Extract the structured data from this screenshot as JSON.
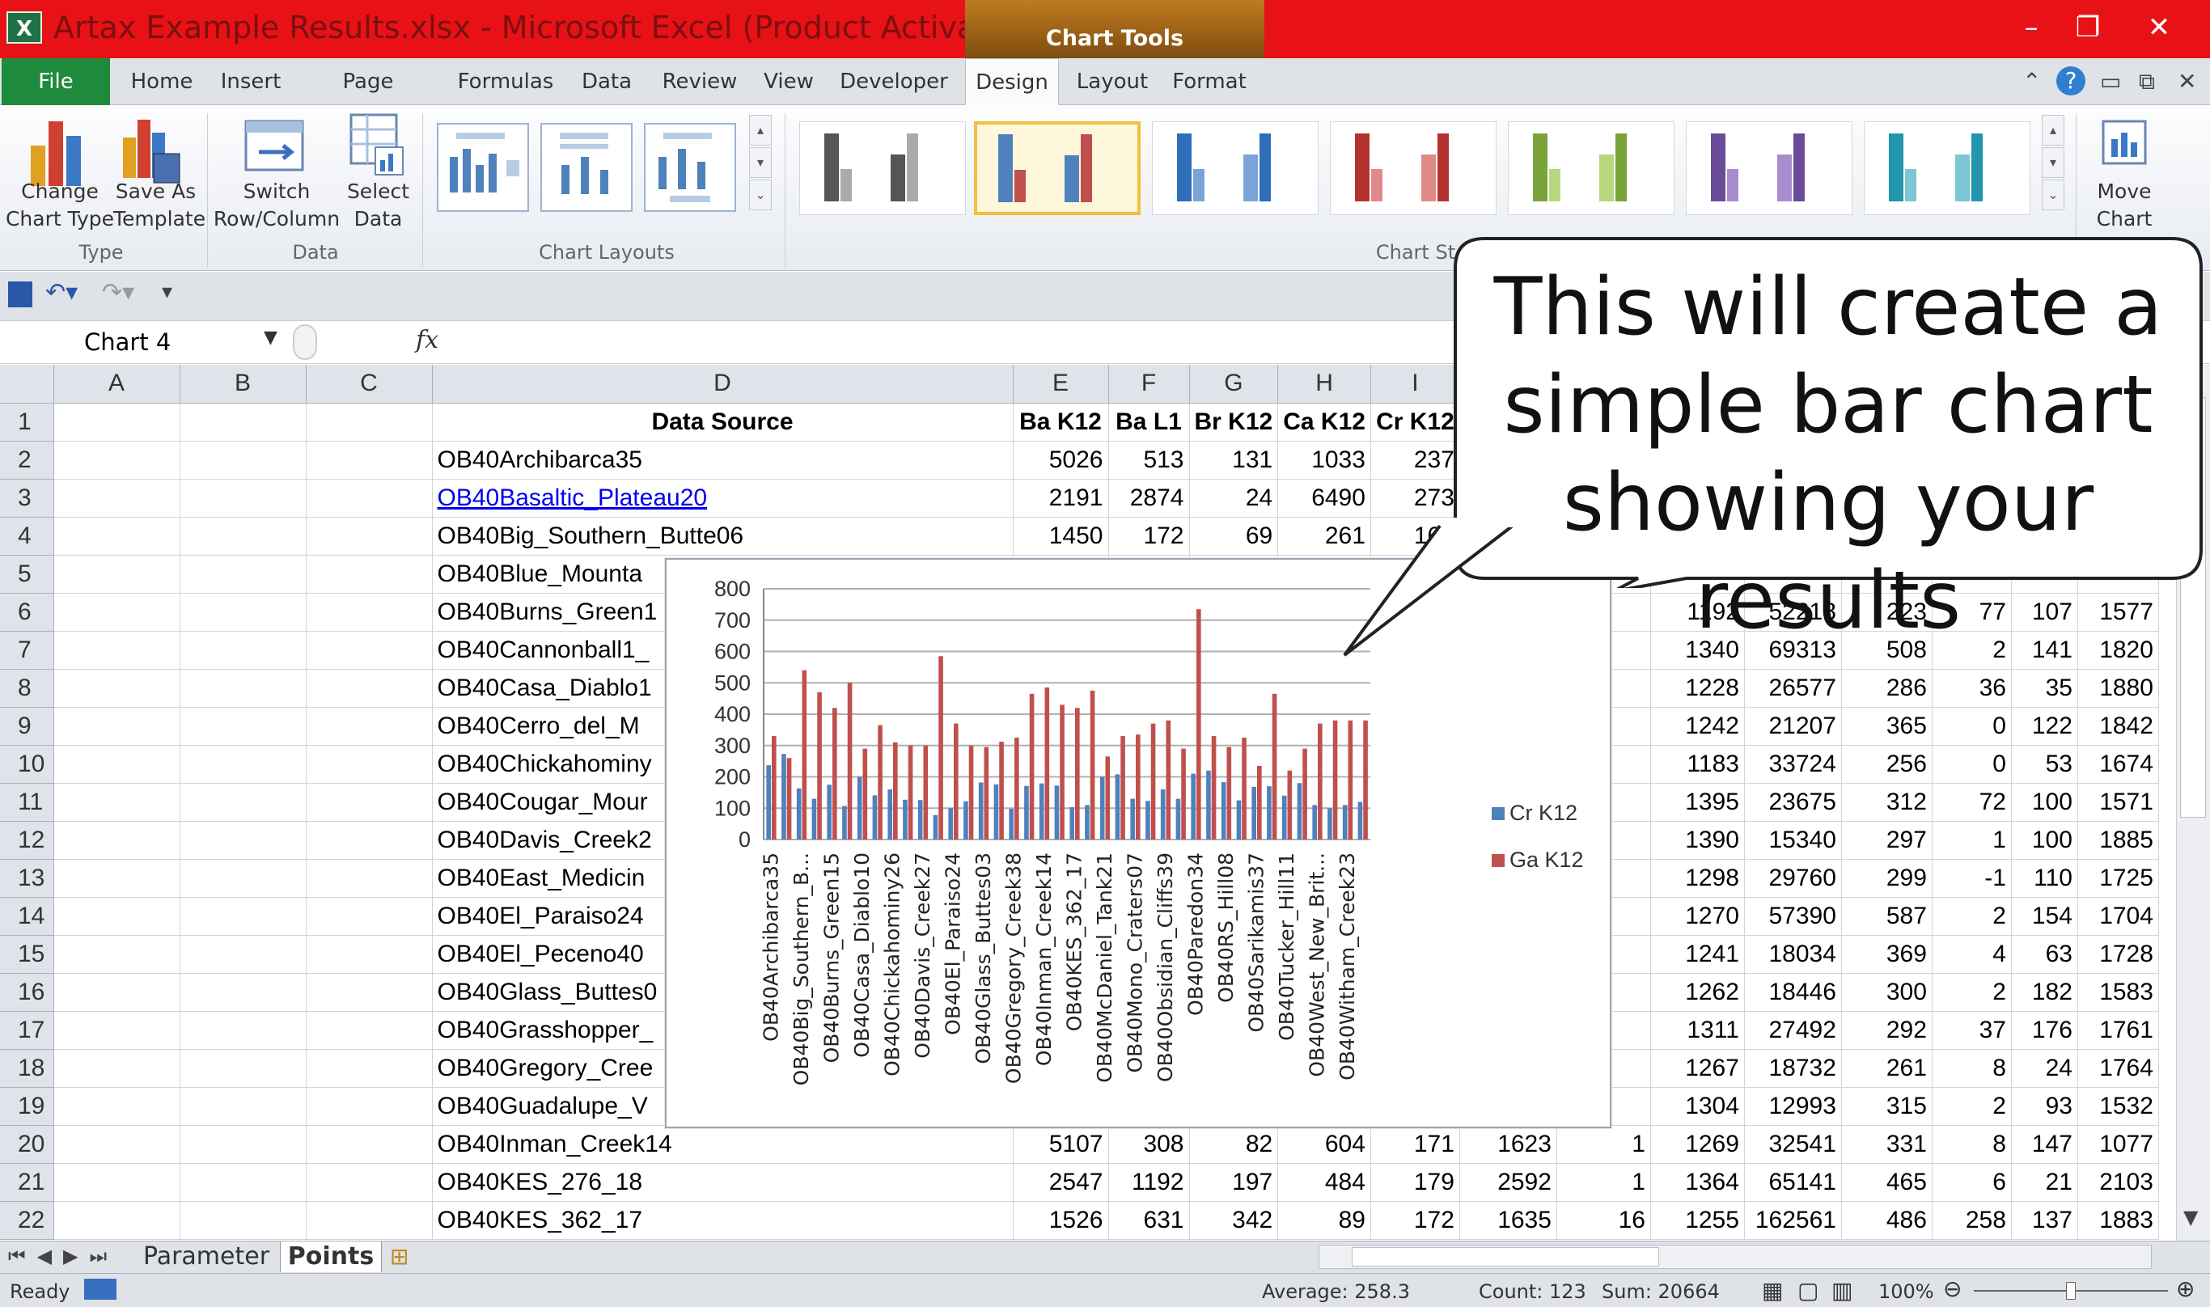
{
  "window": {
    "title": "Artax Example Results.xlsx - Microsoft Excel (Product Activation ...",
    "context_tab_group": "Chart Tools",
    "app_icon": "excel-icon",
    "accent": "#e81115",
    "file_tab_color": "#1e8a3c"
  },
  "tabs": [
    {
      "label": "File",
      "active": false
    },
    {
      "label": "Home",
      "active": false
    },
    {
      "label": "Insert",
      "active": false
    },
    {
      "label": "Page Layout",
      "active": false
    },
    {
      "label": "Formulas",
      "active": false
    },
    {
      "label": "Data",
      "active": false
    },
    {
      "label": "Review",
      "active": false
    },
    {
      "label": "View",
      "active": false
    },
    {
      "label": "Developer",
      "active": false
    },
    {
      "label": "Design",
      "active": true
    },
    {
      "label": "Layout",
      "active": false
    },
    {
      "label": "Format",
      "active": false
    }
  ],
  "ribbon": {
    "change_chart_type": [
      "Change",
      "Chart Type"
    ],
    "save_as_template": [
      "Save As",
      "Template"
    ],
    "switch_row_column": [
      "Switch",
      "Row/Column"
    ],
    "select_data": [
      "Select",
      "Data"
    ],
    "move_chart": [
      "Move",
      "Chart"
    ],
    "groups": {
      "type": "Type",
      "data": "Data",
      "layouts": "Chart Layouts",
      "styles": "Chart St"
    },
    "style_colors": [
      "#666666",
      "#4472c4/#c0504d",
      "#2f6eba",
      "#c0504d",
      "#8db43e",
      "#7a5aa6",
      "#2aa3bc"
    ]
  },
  "formula_bar": {
    "name_box": "Chart 4",
    "fx": "fx",
    "formula": ""
  },
  "columns": [
    "A",
    "B",
    "C",
    "D",
    "E",
    "F",
    "G",
    "H",
    "I"
  ],
  "rows": [
    {
      "n": "1",
      "d": "Data Source",
      "e": "Ba K12",
      "f": "Ba L1",
      "g": "Br K12",
      "h": "Ca K12",
      "i": "Cr K12"
    },
    {
      "n": "2",
      "d": "OB40Archibarca35",
      "e": "5026",
      "f": "513",
      "g": "131",
      "h": "1033",
      "i": "237"
    },
    {
      "n": "3",
      "d": "OB40Basaltic_Plateau20",
      "e": "2191",
      "f": "2874",
      "g": "24",
      "h": "6490",
      "i": "273"
    },
    {
      "n": "4",
      "d": "OB40Big_Southern_Butte06",
      "e": "1450",
      "f": "172",
      "g": "69",
      "h": "261",
      "i": "163"
    },
    {
      "n": "5",
      "d": "OB40Blue_Mounta",
      "r": [
        "",
        "",
        "",
        "",
        "",
        ""
      ]
    },
    {
      "n": "6",
      "d": "OB40Burns_Green1",
      "r": [
        "1192",
        "52218",
        "223",
        "77",
        "107",
        "1577"
      ]
    },
    {
      "n": "7",
      "d": "OB40Cannonball1_",
      "r": [
        "1340",
        "69313",
        "508",
        "2",
        "141",
        "1820"
      ]
    },
    {
      "n": "8",
      "d": "OB40Casa_Diablo1",
      "r": [
        "1228",
        "26577",
        "286",
        "36",
        "35",
        "1880"
      ]
    },
    {
      "n": "9",
      "d": "OB40Cerro_del_M",
      "r": [
        "1242",
        "21207",
        "365",
        "0",
        "122",
        "1842"
      ]
    },
    {
      "n": "10",
      "d": "OB40Chickahominy",
      "r": [
        "1183",
        "33724",
        "256",
        "0",
        "53",
        "1674"
      ]
    },
    {
      "n": "11",
      "d": "OB40Cougar_Mour",
      "r": [
        "1395",
        "23675",
        "312",
        "72",
        "100",
        "1571"
      ]
    },
    {
      "n": "12",
      "d": "OB40Davis_Creek2",
      "r": [
        "1390",
        "15340",
        "297",
        "1",
        "100",
        "1885"
      ]
    },
    {
      "n": "13",
      "d": "OB40East_Medicin",
      "r": [
        "1298",
        "29760",
        "299",
        "-1",
        "110",
        "1725"
      ]
    },
    {
      "n": "14",
      "d": "OB40El_Paraiso24",
      "r": [
        "1270",
        "57390",
        "587",
        "2",
        "154",
        "1704"
      ]
    },
    {
      "n": "15",
      "d": "OB40El_Peceno40",
      "r": [
        "1241",
        "18034",
        "369",
        "4",
        "63",
        "1728"
      ]
    },
    {
      "n": "16",
      "d": "OB40Glass_Buttes0",
      "r": [
        "1262",
        "18446",
        "300",
        "2",
        "182",
        "1583"
      ]
    },
    {
      "n": "17",
      "d": "OB40Grasshopper_",
      "r": [
        "1311",
        "27492",
        "292",
        "37",
        "176",
        "1761"
      ]
    },
    {
      "n": "18",
      "d": "OB40Gregory_Cree",
      "r": [
        "1267",
        "18732",
        "261",
        "8",
        "24",
        "1764"
      ]
    },
    {
      "n": "19",
      "d": "OB40Guadalupe_V",
      "r": [
        "1304",
        "12993",
        "315",
        "2",
        "93",
        "1532"
      ]
    },
    {
      "n": "20",
      "d": "OB40Inman_Creek14",
      "e": "5107",
      "f": "308",
      "g": "82",
      "h": "604",
      "i": "171",
      "r": [
        "1623",
        "1",
        "1269",
        "32541",
        "331",
        "8",
        "147",
        "1077"
      ]
    },
    {
      "n": "21",
      "d": "OB40KES_276_18",
      "e": "2547",
      "f": "1192",
      "g": "197",
      "h": "484",
      "i": "179",
      "r": [
        "2592",
        "1",
        "1364",
        "65141",
        "465",
        "6",
        "21",
        "2103"
      ]
    },
    {
      "n": "22",
      "d": "OB40KES_362_17",
      "e": "1526",
      "f": "631",
      "g": "342",
      "h": "89",
      "i": "172",
      "r": [
        "1635",
        "16",
        "1255",
        "162561",
        "486",
        "258",
        "137",
        "1883"
      ]
    }
  ],
  "sheet_tabs": [
    {
      "label": "Parameter",
      "active": false
    },
    {
      "label": "Points",
      "active": true
    }
  ],
  "status": {
    "ready": "Ready",
    "average": "Average: 258.3",
    "count": "Count: 123",
    "sum": "Sum: 20664",
    "zoom": "100%"
  },
  "callout": {
    "lines": [
      "This will create a",
      "simple bar chart",
      "showing your results"
    ]
  },
  "chart_data": {
    "type": "bar",
    "ylim": [
      0,
      800
    ],
    "yticks": [
      "0",
      "100",
      "200",
      "300",
      "400",
      "500",
      "600",
      "700",
      "800"
    ],
    "category_labels": [
      "OB40Archibarca35",
      "OB40Big_Southern_B...",
      "OB40Burns_Green15",
      "OB40Casa_Diablo10",
      "OB40Chickahominy26",
      "OB40Davis_Creek27",
      "OB40El_Paraiso24",
      "OB40Glass_Buttes03",
      "OB40Gregory_Creek38",
      "OB40Inman_Creek14",
      "OB40KES_362_17",
      "OB40McDaniel_Tank21",
      "OB40Mono_Craters07",
      "OB40Obsidian_Cliffs39",
      "OB40Paredon34",
      "OB40RS_Hill08",
      "OB40Sarikamis37",
      "OB40Tucker_Hill11",
      "OB40West_New_Brit...",
      "OB40Witham_Creek23"
    ],
    "series": [
      {
        "name": "Cr K12",
        "color": "#4f81bd",
        "values": [
          237,
          273,
          163,
          130,
          175,
          107,
          200,
          141,
          160,
          127,
          126,
          78,
          100,
          122,
          182,
          176,
          98,
          171,
          179,
          172,
          103,
          110,
          200,
          208,
          130,
          123,
          160,
          130,
          210,
          220,
          183,
          125,
          168,
          170,
          140,
          180,
          110,
          100,
          110,
          120
        ]
      },
      {
        "name": "Ga K12",
        "color": "#c0504d",
        "values": [
          330,
          260,
          540,
          470,
          420,
          500,
          290,
          365,
          310,
          300,
          300,
          585,
          370,
          300,
          295,
          312,
          325,
          465,
          485,
          430,
          420,
          475,
          265,
          330,
          335,
          370,
          380,
          290,
          735,
          330,
          295,
          325,
          235,
          465,
          220,
          290,
          370,
          380,
          380,
          380
        ]
      }
    ]
  }
}
